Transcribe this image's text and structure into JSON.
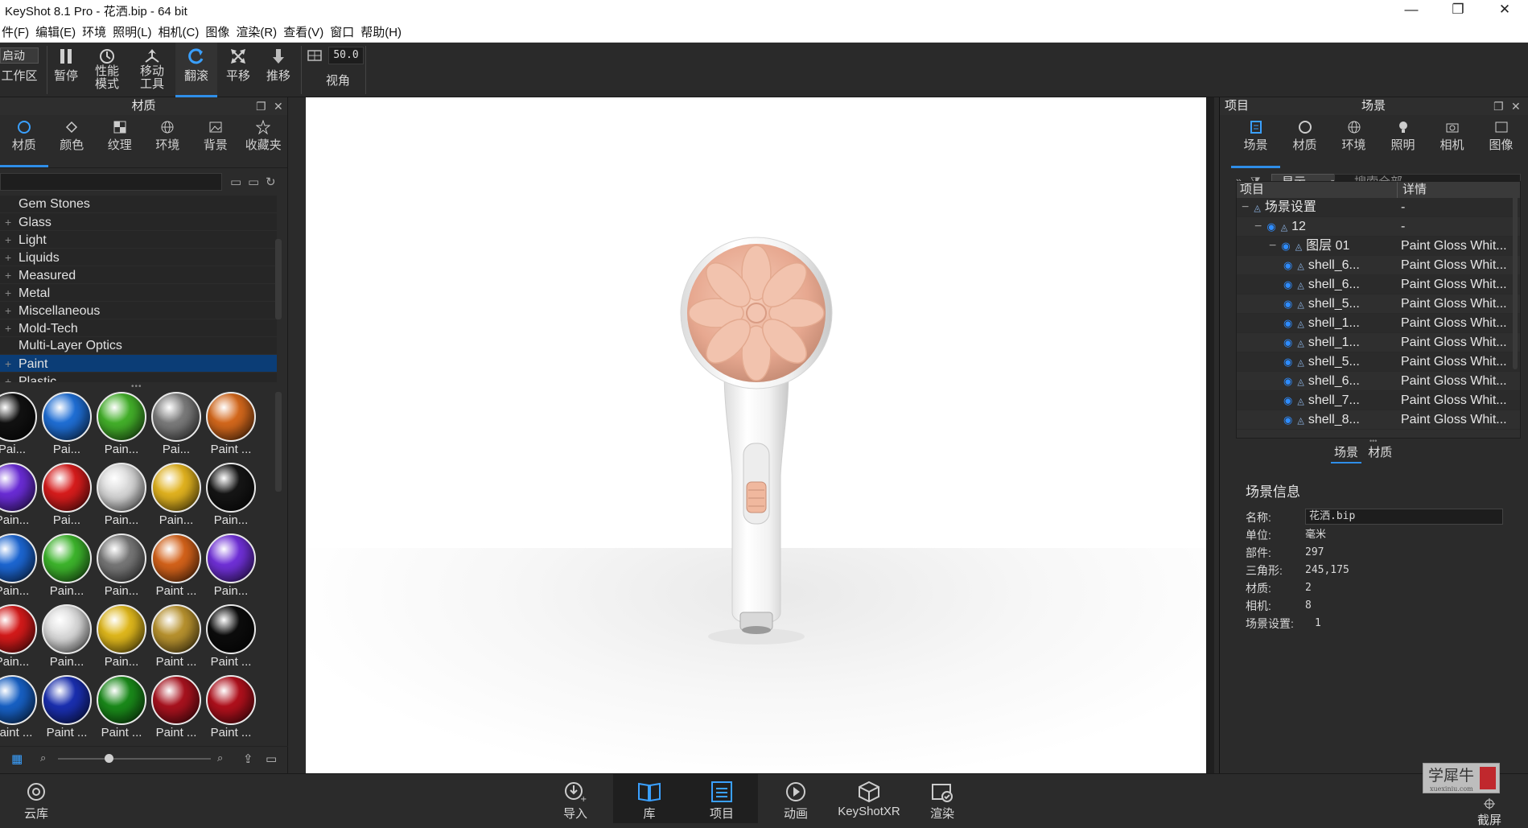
{
  "window": {
    "title": "KeyShot 8.1 Pro  - 花洒.bip  - 64 bit",
    "controls": [
      "minimize-icon",
      "restore-icon",
      "close-icon"
    ]
  },
  "menu": [
    "件(F)",
    "编辑(E)",
    "环境",
    "照明(L)",
    "相机(C)",
    "图像",
    "渲染(R)",
    "查看(V)",
    "窗口",
    "帮助(H)"
  ],
  "toolbar": {
    "start_label": "启动",
    "workspace_label": "工作区",
    "pause_label": "暂停",
    "perf_label_1": "性能",
    "perf_label_2": "模式",
    "move_label_1": "移动",
    "move_label_2": "工具",
    "tumble_label": "翻滚",
    "pan_label": "平移",
    "dolly_label": "推移",
    "fov_value": "50.0",
    "fov_label": "视角"
  },
  "library": {
    "title": "材质",
    "tabs": [
      "材质",
      "颜色",
      "纹理",
      "环境",
      "背景",
      "收藏夹"
    ],
    "tree": [
      {
        "label": "Gem Stones",
        "expand": ""
      },
      {
        "label": "Glass",
        "expand": "+"
      },
      {
        "label": "Light",
        "expand": "+"
      },
      {
        "label": "Liquids",
        "expand": "+"
      },
      {
        "label": "Measured",
        "expand": "+"
      },
      {
        "label": "Metal",
        "expand": "+"
      },
      {
        "label": "Miscellaneous",
        "expand": "+"
      },
      {
        "label": "Mold-Tech",
        "expand": "+"
      },
      {
        "label": "Multi-Layer Optics",
        "expand": ""
      },
      {
        "label": "Paint",
        "expand": "+",
        "selected": true
      },
      {
        "label": "Plastic",
        "expand": "+"
      }
    ],
    "materials": [
      {
        "label": "Pai...",
        "color": "#111111"
      },
      {
        "label": "Pai...",
        "color": "#1f6fd6"
      },
      {
        "label": "Pain...",
        "color": "#43b02a"
      },
      {
        "label": "Pai...",
        "color": "#7b7b7b"
      },
      {
        "label": "Paint ...",
        "color": "#d4681c"
      },
      {
        "label": "Pain...",
        "color": "#6a2cd6"
      },
      {
        "label": "Pai...",
        "color": "#d81c1c"
      },
      {
        "label": "Pain...",
        "color": "#d9d9d9"
      },
      {
        "label": "Pain...",
        "color": "#e2b31f"
      },
      {
        "label": "Pain...",
        "color": "#151515"
      },
      {
        "label": "Pain...",
        "color": "#1c66d2"
      },
      {
        "label": "Pain...",
        "color": "#3db52c"
      },
      {
        "label": "Pain...",
        "color": "#777777"
      },
      {
        "label": "Paint ...",
        "color": "#d4621a"
      },
      {
        "label": "Pain...",
        "color": "#7030d8"
      },
      {
        "label": "Pain...",
        "color": "#d41a1a"
      },
      {
        "label": "Pain...",
        "color": "#dcdcdc"
      },
      {
        "label": "Pain...",
        "color": "#e0b81c"
      },
      {
        "label": "Paint ...",
        "color": "#b8922e"
      },
      {
        "label": "Paint ...",
        "color": "#0c0c0c"
      },
      {
        "label": "Paint ...",
        "color": "#1760c4"
      },
      {
        "label": "Paint ...",
        "color": "#1a2fb0"
      },
      {
        "label": "Paint ...",
        "color": "#1a8a1a"
      },
      {
        "label": "Paint ...",
        "color": "#a8121e"
      },
      {
        "label": "Paint ...",
        "color": "#b0101c"
      }
    ]
  },
  "project": {
    "header_left": "项目",
    "header_center": "场景",
    "tabs": [
      "场景",
      "材质",
      "环境",
      "照明",
      "相机",
      "图像"
    ],
    "show_label": "显示",
    "search_placeholder": "搜索全部",
    "col_item": "项目",
    "col_detail": "详情",
    "rows": [
      {
        "name": "场景设置",
        "detail": "-",
        "level": 0,
        "expand": "−",
        "eye": false
      },
      {
        "name": "12",
        "detail": "-",
        "level": 1,
        "expand": "−",
        "eye": true
      },
      {
        "name": "图层 01",
        "detail": "Paint Gloss Whit...",
        "level": 2,
        "expand": "−",
        "eye": true
      },
      {
        "name": "shell_6...",
        "detail": "Paint Gloss Whit...",
        "level": 3,
        "expand": "",
        "eye": true
      },
      {
        "name": "shell_6...",
        "detail": "Paint Gloss Whit...",
        "level": 3,
        "expand": "",
        "eye": true
      },
      {
        "name": "shell_5...",
        "detail": "Paint Gloss Whit...",
        "level": 3,
        "expand": "",
        "eye": true
      },
      {
        "name": "shell_1...",
        "detail": "Paint Gloss Whit...",
        "level": 3,
        "expand": "",
        "eye": true
      },
      {
        "name": "shell_1...",
        "detail": "Paint Gloss Whit...",
        "level": 3,
        "expand": "",
        "eye": true
      },
      {
        "name": "shell_5...",
        "detail": "Paint Gloss Whit...",
        "level": 3,
        "expand": "",
        "eye": true
      },
      {
        "name": "shell_6...",
        "detail": "Paint Gloss Whit...",
        "level": 3,
        "expand": "",
        "eye": true
      },
      {
        "name": "shell_7...",
        "detail": "Paint Gloss Whit...",
        "level": 3,
        "expand": "",
        "eye": true
      },
      {
        "name": "shell_8...",
        "detail": "Paint Gloss Whit...",
        "level": 3,
        "expand": "",
        "eye": true
      }
    ],
    "subtabs": [
      "场景",
      "材质"
    ],
    "info": {
      "title": "场景信息",
      "name_label": "名称:",
      "name_value": "花洒.bip",
      "unit_label": "单位:",
      "unit_value": "毫米",
      "parts_label": "部件:",
      "parts_value": "297",
      "tris_label": "三角形:",
      "tris_value": "245,175",
      "materials_label": "材质:",
      "materials_value": "2",
      "cameras_label": "相机:",
      "cameras_value": "8",
      "scenesets_label": "场景设置:",
      "scenesets_value": "1"
    }
  },
  "bottom": {
    "cloud": "云库",
    "import": "导入",
    "library": "库",
    "project": "项目",
    "animation": "动画",
    "keyshotxr": "KeyShotXR",
    "render": "渲染",
    "screenshot": "截屏"
  },
  "watermark": {
    "text": "学犀牛",
    "sub": "xuexiniu.com"
  },
  "colors": {
    "accent": "#2f8ee8",
    "selected": "#0b3d76",
    "product_accent": "#e9a98e"
  }
}
